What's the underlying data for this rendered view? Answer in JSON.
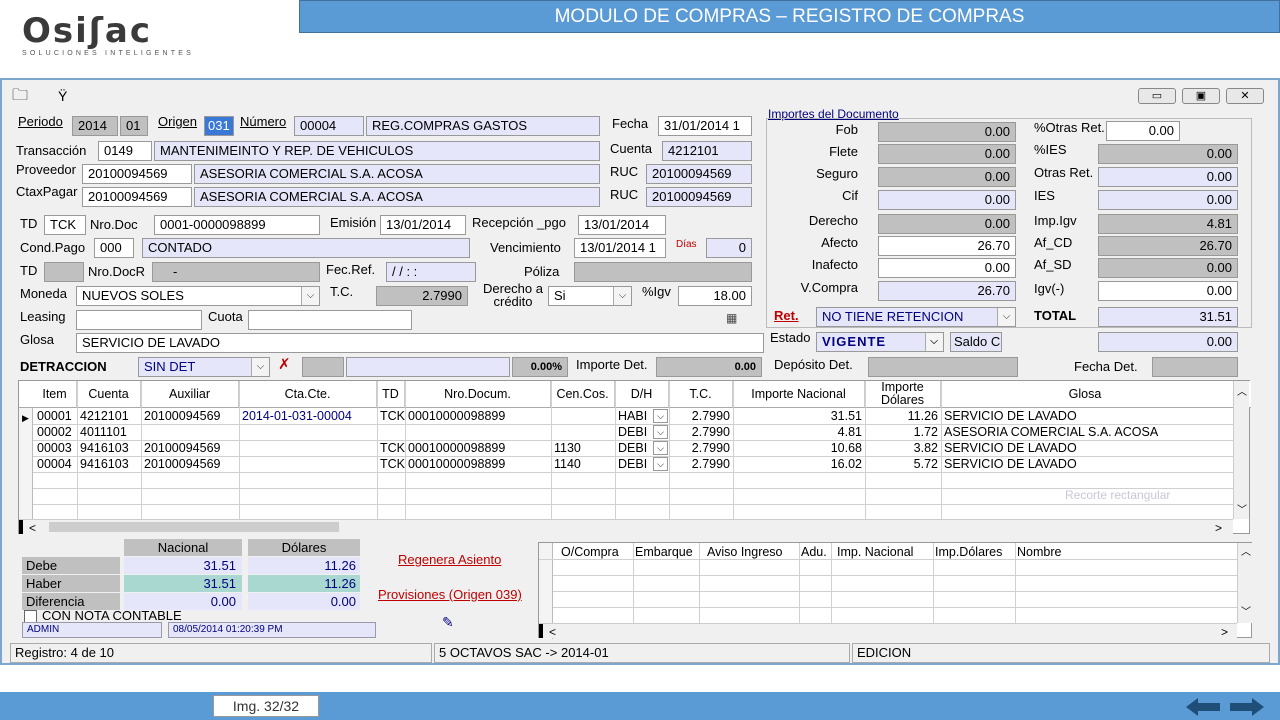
{
  "brand": {
    "logo": "Osiʃac",
    "tagline": "SOLUCIONES INTELIGENTES"
  },
  "banner": {
    "title": "MODULO DE COMPRAS – REGISTRO DE COMPRAS"
  },
  "window": {
    "menu": "Ÿ",
    "minimize": "▭",
    "restore": "▣",
    "close": "✕"
  },
  "header": {
    "periodo_label": "Periodo",
    "periodo_year": "2014",
    "periodo_month": "01",
    "origen_label": "Origen",
    "origen": "031",
    "numero_label": "Número",
    "numero": "00004",
    "numero_desc": "REG.COMPRAS GASTOS",
    "fecha_label": "Fecha",
    "fecha": "31/01/2014 1",
    "transaccion_label": "Transacción",
    "transaccion": "0149",
    "transaccion_desc": "MANTENIMEINTO Y REP. DE VEHICULOS",
    "cuenta_label": "Cuenta",
    "cuenta": "4212101",
    "proveedor_label": "Proveedor",
    "proveedor": "20100094569",
    "proveedor_desc": "ASESORIA COMERCIAL S.A. ACOSA",
    "ruc_label": "RUC",
    "ruc1": "20100094569",
    "ctaxpagar_label": "CtaxPagar",
    "ctaxpagar": "20100094569",
    "ctaxpagar_desc": "ASESORIA COMERCIAL S.A. ACOSA",
    "ruc2": "20100094569"
  },
  "doc": {
    "td_label": "TD",
    "td": "TCK",
    "nrodoc_label": "Nro.Doc",
    "nrodoc": "0001-0000098899",
    "emision_label": "Emisión",
    "emision": "13/01/2014",
    "recepcion_label": "Recepción _pgo",
    "recepcion": "13/01/2014",
    "condpago_label": "Cond.Pago",
    "condpago": "000",
    "condpago_desc": "CONTADO",
    "vencimiento_label": "Vencimiento",
    "vencimiento": "13/01/2014 1",
    "dias_label": "Días",
    "dias": "0",
    "td2_label": "TD",
    "nrodocr_label": "Nro.DocR",
    "nrodocr": "-",
    "fecref_label": "Fec.Ref.",
    "fecref": " / /     : :",
    "poliza_label": "Póliza",
    "moneda_label": "Moneda",
    "moneda": "NUEVOS SOLES",
    "tc_label": "T.C.",
    "tc": "2.7990",
    "derecho_label": "Derecho a crédito",
    "derecho": "Si",
    "igv_label": "%Igv",
    "igv": "18.00",
    "leasing_label": "Leasing",
    "cuota_label": "Cuota",
    "glosa_label": "Glosa",
    "glosa": "SERVICIO DE LAVADO",
    "detraccion_label": "DETRACCION",
    "detraccion": "SIN DET",
    "det_pct": "0.00%",
    "importe_det_label": "Importe Det.",
    "importe_det": "0.00",
    "deposito_label": "Depósito Det.",
    "fecha_det_label": "Fecha Det."
  },
  "importes": {
    "title": "Importes del Documento",
    "left": [
      {
        "label": "Fob",
        "value": "0.00"
      },
      {
        "label": "Flete",
        "value": "0.00"
      },
      {
        "label": "Seguro",
        "value": "0.00"
      },
      {
        "label": "Cif",
        "value": "0.00"
      },
      {
        "label": "Derecho",
        "value": "0.00"
      },
      {
        "label": "Afecto",
        "value": "26.70"
      },
      {
        "label": "Inafecto",
        "value": "0.00"
      },
      {
        "label": "V.Compra",
        "value": "26.70"
      }
    ],
    "right": [
      {
        "label": "%Otras Ret.",
        "value": "0.00"
      },
      {
        "label": "%IES",
        "value": "0.00"
      },
      {
        "label": "Otras Ret.",
        "value": "0.00"
      },
      {
        "label": "IES",
        "value": "0.00"
      },
      {
        "label": "Imp.Igv",
        "value": "4.81"
      },
      {
        "label": "Af_CD",
        "value": "26.70"
      },
      {
        "label": "Af_SD",
        "value": "0.00"
      },
      {
        "label": "Igv(-)",
        "value": "0.00"
      }
    ],
    "ret_label": "Ret.",
    "ret": "NO TIENE RETENCION",
    "total_label": "TOTAL",
    "total": "31.51",
    "estado_label": "Estado",
    "estado": "VIGENTE",
    "saldo": "Saldo C",
    "saldo_value": "0.00"
  },
  "grid": {
    "columns": [
      "Item",
      "Cuenta",
      "Auxiliar",
      "Cta.Cte.",
      "TD",
      "Nro.Docum.",
      "Cen.Cos.",
      "D/H",
      "T.C.",
      "Importe Nacional",
      "Importe Dólares",
      "Glosa"
    ],
    "rows": [
      {
        "item": "00001",
        "cuenta": "4212101",
        "auxiliar": "20100094569",
        "ctacte": "2014-01-031-00004",
        "td": "TCK",
        "nro": "00010000098899",
        "cen": "",
        "dh": "HABI",
        "tc": "2.7990",
        "nac": "31.51",
        "dol": "11.26",
        "glosa": "SERVICIO DE LAVADO"
      },
      {
        "item": "00002",
        "cuenta": "4011101",
        "auxiliar": "",
        "ctacte": "",
        "td": "",
        "nro": "",
        "cen": "",
        "dh": "DEBI",
        "tc": "2.7990",
        "nac": "4.81",
        "dol": "1.72",
        "glosa": "ASESORIA COMERCIAL S.A. ACOSA"
      },
      {
        "item": "00003",
        "cuenta": "9416103",
        "auxiliar": "20100094569",
        "ctacte": "",
        "td": "TCK",
        "nro": "00010000098899",
        "cen": "1130",
        "dh": "DEBI",
        "tc": "2.7990",
        "nac": "10.68",
        "dol": "3.82",
        "glosa": "SERVICIO DE LAVADO"
      },
      {
        "item": "00004",
        "cuenta": "9416103",
        "auxiliar": "20100094569",
        "ctacte": "",
        "td": "TCK",
        "nro": "00010000098899",
        "cen": "1140",
        "dh": "DEBI",
        "tc": "2.7990",
        "nac": "16.02",
        "dol": "5.72",
        "glosa": "SERVICIO DE LAVADO"
      }
    ],
    "ghost": "Recorte rectangular"
  },
  "totals": {
    "nacional_label": "Nacional",
    "dolares_label": "Dólares",
    "debe_label": "Debe",
    "debe_nac": "31.51",
    "debe_dol": "11.26",
    "haber_label": "Haber",
    "haber_nac": "31.51",
    "haber_dol": "11.26",
    "dif_label": "Diferencia",
    "dif_nac": "0.00",
    "dif_dol": "0.00",
    "nota_label": "CON NOTA CONTABLE",
    "user": "ADMIN",
    "timestamp": "08/05/2014 01:20:39 PM"
  },
  "links": {
    "regenera": "Regenera Asiento",
    "provisiones": "Provisiones (Origen 039)"
  },
  "subgrid": {
    "columns": [
      "O/Compra",
      "Embarque",
      "Aviso Ingreso",
      "Adu.",
      "Imp. Nacional",
      "Imp.Dólares",
      "Nombre"
    ]
  },
  "status": {
    "registro": "Registro: 4 de 10",
    "company": "5 OCTAVOS SAC -> 2014-01",
    "mode": "EDICION"
  },
  "footer": {
    "img": "Img. 32/32"
  }
}
